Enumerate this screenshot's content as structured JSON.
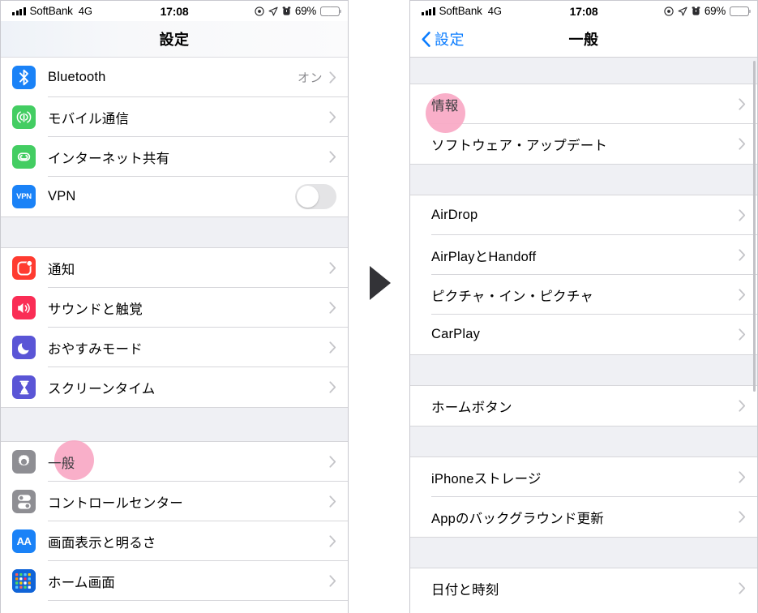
{
  "status_bar": {
    "carrier": "SoftBank",
    "network": "4G",
    "time": "17:08",
    "battery_percent": "69%",
    "icons": [
      "signal-bars-icon",
      "do-not-disturb-icon",
      "location-arrow-icon",
      "alarm-clock-icon",
      "battery-charging-icon"
    ]
  },
  "colors": {
    "accent_blue": "#0a7cff",
    "highlight_pink": "#f9a8c4",
    "group_background": "#eff0f4",
    "separator": "#d6d6da",
    "chevron_gray": "#c4c4c8",
    "value_gray": "#8a8a8e",
    "battery_green": "#3ad64a"
  },
  "left_panel": {
    "nav": {
      "title": "設定"
    },
    "groups": [
      {
        "rows": [
          {
            "icon": "bluetooth-icon",
            "icon_color": "#1a82f7",
            "label": "Bluetooth",
            "value": "オン",
            "accessory": "chevron"
          },
          {
            "icon": "cellular-antenna-icon",
            "icon_color": "#43cd62",
            "label": "モバイル通信",
            "value": "",
            "accessory": "chevron"
          },
          {
            "icon": "personal-hotspot-icon",
            "icon_color": "#43cd62",
            "label": "インターネット共有",
            "value": "",
            "accessory": "chevron"
          },
          {
            "icon": "vpn-icon",
            "icon_color": "#1a82f7",
            "label": "VPN",
            "value": "",
            "accessory": "toggle",
            "toggle_on": false
          }
        ]
      },
      {
        "rows": [
          {
            "icon": "notifications-icon",
            "icon_color": "#ff3b30",
            "label": "通知",
            "value": "",
            "accessory": "chevron"
          },
          {
            "icon": "sounds-haptics-icon",
            "icon_color": "#fa2d55",
            "label": "サウンドと触覚",
            "value": "",
            "accessory": "chevron"
          },
          {
            "icon": "do-not-disturb-moon-icon",
            "icon_color": "#5a55d6",
            "label": "おやすみモード",
            "value": "",
            "accessory": "chevron"
          },
          {
            "icon": "screen-time-hourglass-icon",
            "icon_color": "#5a55d6",
            "label": "スクリーンタイム",
            "value": "",
            "accessory": "chevron"
          }
        ]
      },
      {
        "rows": [
          {
            "icon": "gear-icon",
            "icon_color": "#8e8e93",
            "label": "一般",
            "value": "",
            "accessory": "chevron",
            "highlighted": true
          },
          {
            "icon": "control-center-icon",
            "icon_color": "#8e8e93",
            "label": "コントロールセンター",
            "value": "",
            "accessory": "chevron"
          },
          {
            "icon": "display-brightness-aa-icon",
            "icon_color": "#1a82f7",
            "label": "画面表示と明るさ",
            "value": "",
            "accessory": "chevron"
          },
          {
            "icon": "home-screen-grid-icon",
            "icon_color": "#1a82f7",
            "label": "ホーム画面",
            "value": "",
            "accessory": "chevron"
          }
        ]
      }
    ]
  },
  "right_panel": {
    "nav": {
      "back_label": "設定",
      "title": "一般",
      "back_icon": "chevron-left-icon"
    },
    "groups": [
      {
        "rows": [
          {
            "label": "情報",
            "accessory": "chevron",
            "highlighted": true
          },
          {
            "label": "ソフトウェア・アップデート",
            "accessory": "chevron"
          }
        ]
      },
      {
        "rows": [
          {
            "label": "AirDrop",
            "accessory": "chevron"
          },
          {
            "label": "AirPlayとHandoff",
            "accessory": "chevron"
          },
          {
            "label": "ピクチャ・イン・ピクチャ",
            "accessory": "chevron"
          },
          {
            "label": "CarPlay",
            "accessory": "chevron"
          }
        ]
      },
      {
        "rows": [
          {
            "label": "ホームボタン",
            "accessory": "chevron"
          }
        ]
      },
      {
        "rows": [
          {
            "label": "iPhoneストレージ",
            "accessory": "chevron"
          },
          {
            "label": "Appのバックグラウンド更新",
            "accessory": "chevron"
          }
        ]
      },
      {
        "rows": [
          {
            "label": "日付と時刻",
            "accessory": "chevron"
          }
        ]
      }
    ]
  },
  "flow": {
    "arrow": "play-arrow-right-icon"
  }
}
